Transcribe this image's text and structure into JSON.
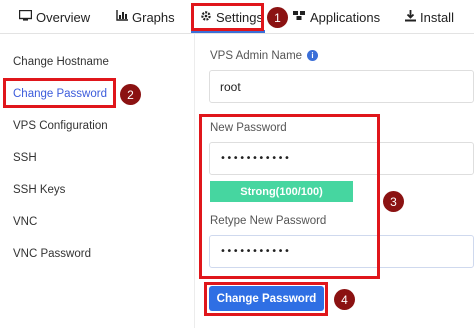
{
  "tabs": [
    {
      "label": "Overview",
      "icon": "monitor-icon"
    },
    {
      "label": "Graphs",
      "icon": "bar-chart-icon"
    },
    {
      "label": "Settings",
      "icon": "gear-icon"
    },
    {
      "label": "Applications",
      "icon": "boxes-icon"
    },
    {
      "label": "Install",
      "icon": "download-icon"
    }
  ],
  "active_tab": "Settings",
  "sidebar": {
    "items": [
      {
        "label": "Change Hostname"
      },
      {
        "label": "Change Password"
      },
      {
        "label": "VPS Configuration"
      },
      {
        "label": "SSH"
      },
      {
        "label": "SSH Keys"
      },
      {
        "label": "VNC"
      },
      {
        "label": "VNC Password"
      }
    ],
    "active": "Change Password"
  },
  "form": {
    "admin_name_label": "VPS Admin Name",
    "admin_name_value": "root",
    "new_password_label": "New Password",
    "new_password_value": "•••••••••••",
    "strength_text": "Strong(100/100)",
    "retype_label": "Retype New Password",
    "retype_value": "•••••••••••",
    "submit_label": "Change Password"
  },
  "steps": [
    "1",
    "2",
    "3",
    "4"
  ],
  "colors": {
    "highlight": "#e0161b",
    "step_marker": "#8b1212",
    "accent": "#3b6fd8",
    "strength_bar": "#46d6a0",
    "button": "#2f6fe4"
  }
}
